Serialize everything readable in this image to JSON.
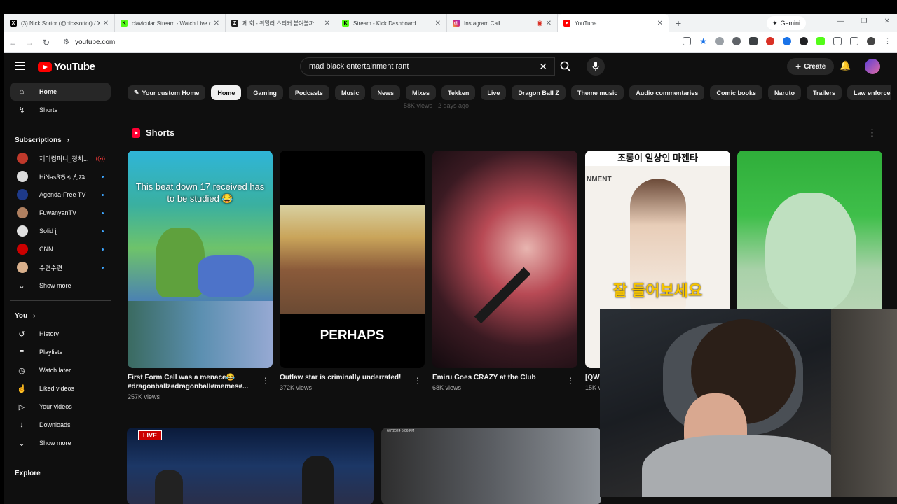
{
  "browser": {
    "tabs": [
      {
        "label": "(3) Nick Sortor (@nicksortor) / X",
        "fav_color": "#000000",
        "fav_glyph": "X"
      },
      {
        "label": "clavicular Stream - Watch Live o",
        "fav_color": "#53fc18",
        "fav_glyph": "K"
      },
      {
        "label": "제 회 - 귀밀러 스티커 붙여볼까",
        "fav_color": "#1f1f1f",
        "fav_glyph": "Z"
      },
      {
        "label": "Stream - Kick Dashboard",
        "fav_color": "#53fc18",
        "fav_glyph": "K"
      },
      {
        "label": "Instagram Call",
        "fav_color": "#d62976",
        "fav_glyph": "◎"
      },
      {
        "label": "YouTube",
        "fav_color": "#ff0000",
        "fav_glyph": "▶"
      }
    ],
    "gemini_label": "Gemini",
    "url": "youtube.com"
  },
  "youtube": {
    "logo_text": "YouTube",
    "search_value": "mad black entertainment rant",
    "create_label": "Create",
    "sidebar": {
      "main": [
        {
          "label": "Home",
          "icon": "home-icon",
          "glyph": "⌂"
        },
        {
          "label": "Shorts",
          "icon": "shorts-icon",
          "glyph": "↯"
        }
      ],
      "subscriptions_title": "Subscriptions",
      "subscriptions": [
        {
          "label": "제이컴퍼니_정치...",
          "color": "#c0392b",
          "status": "live"
        },
        {
          "label": "HiNas3ちゃんね...",
          "color": "#dddddd",
          "status": "dot"
        },
        {
          "label": "Agenda-Free TV",
          "color": "#1e3a8a",
          "status": "dot"
        },
        {
          "label": "FuwanyanTV",
          "color": "#b08060",
          "status": "dot"
        },
        {
          "label": "Solid jj",
          "color": "#e0e0e0",
          "status": "dot"
        },
        {
          "label": "CNN",
          "color": "#cc0000",
          "status": "dot"
        },
        {
          "label": "수련수련",
          "color": "#d9b08c",
          "status": "dot"
        }
      ],
      "show_more": "Show more",
      "you_title": "You",
      "you_items": [
        {
          "label": "History",
          "icon": "history-icon",
          "glyph": "↺"
        },
        {
          "label": "Playlists",
          "icon": "playlists-icon",
          "glyph": "≡"
        },
        {
          "label": "Watch later",
          "icon": "clock-icon",
          "glyph": "◷"
        },
        {
          "label": "Liked videos",
          "icon": "thumbs-up-icon",
          "glyph": "👍"
        },
        {
          "label": "Your videos",
          "icon": "your-videos-icon",
          "glyph": "▷"
        },
        {
          "label": "Downloads",
          "icon": "download-icon",
          "glyph": "↓"
        }
      ],
      "show_more_2": "Show more",
      "explore_title": "Explore"
    },
    "chips": [
      "Your custom Home",
      "Home",
      "Gaming",
      "Podcasts",
      "Music",
      "News",
      "Mixes",
      "Tekken",
      "Live",
      "Dragon Ball Z",
      "Theme music",
      "Audio commentaries",
      "Comic books",
      "Naruto",
      "Trailers",
      "Law enforcem"
    ],
    "selected_chip": "Home",
    "faded_meta": "58K views · 2 days ago",
    "shorts_title": "Shorts",
    "shorts": [
      {
        "title": "First Form Cell was a menace😂 #dragonballz#dragonball#memes#...",
        "views": "257K views",
        "overlay": "This beat down 17 received has to be studied 😂"
      },
      {
        "title": "Outlaw star is criminally underrated!",
        "views": "372K views",
        "overlay": "PERHAPS"
      },
      {
        "title": "Emiru Goes CRAZY at the Club",
        "views": "68K views",
        "overlay": ""
      },
      {
        "title": "[QWE",
        "views": "15K v",
        "overlay_top": "조롱이 일상인 마젠타",
        "overlay_sub": "NMENT",
        "overlay_bottom": "잘 들어보세요"
      },
      {
        "title": "",
        "views": "",
        "overlay": ""
      }
    ],
    "row2": [
      {
        "badge": "LIVE"
      },
      {
        "overlay": "6/7/2024 5:06 PM"
      }
    ]
  }
}
